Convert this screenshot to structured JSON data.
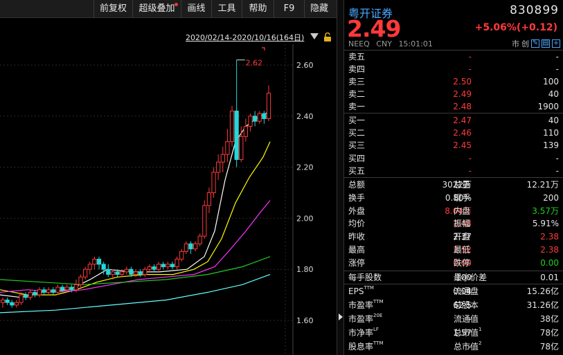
{
  "toolbar": {
    "buttons": [
      "前复权",
      "超级叠加",
      "画线",
      "工具",
      "帮助",
      "F9",
      "隐藏"
    ]
  },
  "range": {
    "text": "2020/02/14-2020/10/16(164日)"
  },
  "chart_data": {
    "type": "candlestick",
    "price_labels": [
      "2.60",
      "2.40",
      "2.20",
      "2.00",
      "1.80",
      "1.60"
    ],
    "price_levels": [
      2.6,
      2.4,
      2.2,
      2.0,
      1.8,
      1.6
    ],
    "ylim": [
      1.52,
      2.68
    ],
    "high_annotation": "2.62",
    "high_value": 2.62,
    "candles": [
      [
        1.67,
        1.68,
        1.65,
        1.69
      ],
      [
        1.68,
        1.67,
        1.66,
        1.69
      ],
      [
        1.67,
        1.66,
        1.65,
        1.68
      ],
      [
        1.66,
        1.67,
        1.65,
        1.68
      ],
      [
        1.67,
        1.7,
        1.66,
        1.71
      ],
      [
        1.7,
        1.69,
        1.68,
        1.71
      ],
      [
        1.69,
        1.71,
        1.68,
        1.72
      ],
      [
        1.71,
        1.7,
        1.69,
        1.72
      ],
      [
        1.7,
        1.72,
        1.69,
        1.73
      ],
      [
        1.72,
        1.71,
        1.7,
        1.73
      ],
      [
        1.71,
        1.72,
        1.7,
        1.73
      ],
      [
        1.72,
        1.71,
        1.7,
        1.73
      ],
      [
        1.71,
        1.73,
        1.7,
        1.74
      ],
      [
        1.73,
        1.72,
        1.71,
        1.74
      ],
      [
        1.72,
        1.73,
        1.71,
        1.74
      ],
      [
        1.73,
        1.72,
        1.71,
        1.74
      ],
      [
        1.72,
        1.74,
        1.71,
        1.76
      ],
      [
        1.74,
        1.77,
        1.73,
        1.78
      ],
      [
        1.77,
        1.8,
        1.76,
        1.81
      ],
      [
        1.8,
        1.82,
        1.78,
        1.83
      ],
      [
        1.82,
        1.84,
        1.8,
        1.85
      ],
      [
        1.84,
        1.82,
        1.8,
        1.85
      ],
      [
        1.82,
        1.8,
        1.78,
        1.83
      ],
      [
        1.8,
        1.78,
        1.77,
        1.82
      ],
      [
        1.78,
        1.79,
        1.76,
        1.8
      ],
      [
        1.79,
        1.78,
        1.77,
        1.8
      ],
      [
        1.78,
        1.79,
        1.77,
        1.8
      ],
      [
        1.79,
        1.8,
        1.78,
        1.81
      ],
      [
        1.8,
        1.78,
        1.77,
        1.81
      ],
      [
        1.78,
        1.79,
        1.77,
        1.8
      ],
      [
        1.79,
        1.78,
        1.77,
        1.8
      ],
      [
        1.78,
        1.8,
        1.77,
        1.81
      ],
      [
        1.8,
        1.81,
        1.79,
        1.82
      ],
      [
        1.81,
        1.8,
        1.79,
        1.82
      ],
      [
        1.8,
        1.82,
        1.79,
        1.83
      ],
      [
        1.82,
        1.81,
        1.8,
        1.83
      ],
      [
        1.81,
        1.82,
        1.8,
        1.83
      ],
      [
        1.82,
        1.81,
        1.8,
        1.83
      ],
      [
        1.81,
        1.84,
        1.8,
        1.85
      ],
      [
        1.84,
        1.87,
        1.83,
        1.88
      ],
      [
        1.87,
        1.9,
        1.86,
        1.91
      ],
      [
        1.9,
        1.88,
        1.86,
        1.91
      ],
      [
        1.88,
        1.9,
        1.87,
        1.91
      ],
      [
        1.9,
        1.93,
        1.89,
        1.94
      ],
      [
        1.93,
        2.05,
        1.92,
        2.07
      ],
      [
        2.05,
        2.1,
        2.02,
        2.12
      ],
      [
        2.1,
        2.18,
        2.08,
        2.2
      ],
      [
        2.18,
        2.22,
        2.15,
        2.25
      ],
      [
        2.22,
        2.25,
        2.18,
        2.28
      ],
      [
        2.25,
        2.3,
        2.22,
        2.35
      ],
      [
        2.3,
        2.42,
        2.28,
        2.44
      ],
      [
        2.42,
        2.23,
        2.2,
        2.62
      ],
      [
        2.23,
        2.32,
        2.22,
        2.36
      ],
      [
        2.32,
        2.36,
        2.3,
        2.39
      ],
      [
        2.36,
        2.4,
        2.34,
        2.41
      ],
      [
        2.4,
        2.38,
        2.36,
        2.42
      ],
      [
        2.38,
        2.41,
        2.37,
        2.42
      ],
      [
        2.41,
        2.39,
        2.37,
        2.42
      ],
      [
        2.39,
        2.49,
        2.38,
        2.52
      ]
    ],
    "ma_series": [
      {
        "color": "#ffffff",
        "points": [
          [
            0,
            1.7
          ],
          [
            30,
            1.69
          ],
          [
            60,
            1.71
          ],
          [
            100,
            1.72
          ],
          [
            130,
            1.76
          ],
          [
            155,
            1.8
          ],
          [
            190,
            1.79
          ],
          [
            230,
            1.79
          ],
          [
            270,
            1.8
          ],
          [
            295,
            1.85
          ],
          [
            310,
            1.95
          ],
          [
            325,
            2.15
          ],
          [
            340,
            2.3
          ],
          [
            355,
            2.36
          ],
          [
            370,
            2.39
          ],
          [
            390,
            2.42
          ]
        ]
      },
      {
        "color": "#ffff00",
        "points": [
          [
            0,
            1.72
          ],
          [
            40,
            1.7
          ],
          [
            80,
            1.7
          ],
          [
            110,
            1.72
          ],
          [
            140,
            1.75
          ],
          [
            170,
            1.77
          ],
          [
            210,
            1.78
          ],
          [
            250,
            1.78
          ],
          [
            280,
            1.8
          ],
          [
            300,
            1.83
          ],
          [
            320,
            1.92
          ],
          [
            340,
            2.06
          ],
          [
            360,
            2.16
          ],
          [
            380,
            2.24
          ],
          [
            390,
            2.3
          ]
        ]
      },
      {
        "color": "#ff33ff",
        "points": [
          [
            0,
            1.71
          ],
          [
            40,
            1.72
          ],
          [
            80,
            1.71
          ],
          [
            120,
            1.72
          ],
          [
            160,
            1.74
          ],
          [
            200,
            1.76
          ],
          [
            240,
            1.77
          ],
          [
            280,
            1.78
          ],
          [
            310,
            1.81
          ],
          [
            330,
            1.87
          ],
          [
            355,
            1.95
          ],
          [
            375,
            2.02
          ],
          [
            390,
            2.07
          ]
        ]
      },
      {
        "color": "#22cc22",
        "points": [
          [
            0,
            1.76
          ],
          [
            60,
            1.75
          ],
          [
            120,
            1.74
          ],
          [
            180,
            1.75
          ],
          [
            240,
            1.76
          ],
          [
            300,
            1.78
          ],
          [
            350,
            1.81
          ],
          [
            390,
            1.85
          ]
        ]
      },
      {
        "color": "#66ffff",
        "points": [
          [
            0,
            1.63
          ],
          [
            80,
            1.64
          ],
          [
            160,
            1.66
          ],
          [
            240,
            1.68
          ],
          [
            300,
            1.71
          ],
          [
            350,
            1.74
          ],
          [
            390,
            1.78
          ]
        ]
      }
    ]
  },
  "quote": {
    "name": "粤开证券",
    "code": "830899",
    "price": "2.49",
    "change": "+5.06%(+0.12)",
    "market": "NEEQ",
    "currency": "CNY",
    "time": "15:01:01",
    "icons": [
      "市",
      "创"
    ],
    "asks": [
      {
        "label": "卖五",
        "price": "-",
        "vol": "-"
      },
      {
        "label": "卖四",
        "price": "-",
        "vol": "-"
      },
      {
        "label": "卖三",
        "price": "2.50",
        "vol": "100"
      },
      {
        "label": "卖二",
        "price": "2.49",
        "vol": "40"
      },
      {
        "label": "卖一",
        "price": "2.48",
        "vol": "1900"
      }
    ],
    "bids": [
      {
        "label": "买一",
        "price": "2.47",
        "vol": "40"
      },
      {
        "label": "买二",
        "price": "2.46",
        "vol": "110"
      },
      {
        "label": "买三",
        "price": "2.45",
        "vol": "139"
      },
      {
        "label": "买四",
        "price": "-",
        "vol": "-"
      },
      {
        "label": "买五",
        "price": "-",
        "vol": "-"
      }
    ],
    "stats": [
      {
        "l1": "总额",
        "v1": "3022万",
        "c1": "white",
        "l2": "总量",
        "v2": "12.21万",
        "c2": "white"
      },
      {
        "l1": "换手",
        "v1": "0.80%",
        "c1": "white",
        "l2": "现手",
        "v2": "200",
        "c2": "white"
      },
      {
        "l1": "外盘",
        "v1": "8.64万",
        "c1": "red",
        "l2": "内盘",
        "v2": "3.57万",
        "c2": "green"
      },
      {
        "l1": "均价",
        "v1": "2.48",
        "c1": "red",
        "l2": "振幅",
        "v2": "5.91%",
        "c2": "white"
      },
      {
        "l1": "昨收",
        "v1": "2.37",
        "c1": "white",
        "l2": "开盘",
        "v2": "2.38",
        "c2": "red"
      },
      {
        "l1": "最高",
        "v1": "2.52",
        "c1": "red",
        "l2": "最低",
        "v2": "2.38",
        "c2": "red"
      },
      {
        "l1": "涨停",
        "v1": "0.00",
        "c1": "red",
        "l2": "跌停",
        "v2": "0.00",
        "c2": "green"
      }
    ],
    "lot": {
      "l1": "每手股数",
      "v1": "100",
      "l2": "最小价差",
      "v2": "0.01"
    },
    "fundamentals": [
      {
        "l1": "EPS",
        "s1": "TTM",
        "v1": "0.04",
        "l2": "流通盘",
        "s2": "",
        "v2": "15.26亿"
      },
      {
        "l1": "市盈率",
        "s1": "TTM",
        "v1": "62.5",
        "l2": "总股本",
        "s2": "",
        "v2": "31.26亿"
      },
      {
        "l1": "市盈率",
        "s1": "20E",
        "v1": "-",
        "l2": "流通值",
        "s2": "",
        "v2": "38亿"
      },
      {
        "l1": "市净率",
        "s1": "LF",
        "v1": "1.57",
        "l2": "总市值",
        "s2": "1",
        "v2": "78亿"
      },
      {
        "l1": "股息率",
        "s1": "TTM",
        "v1": "-",
        "l2": "总市值",
        "s2": "2",
        "v2": "78亿"
      }
    ]
  }
}
